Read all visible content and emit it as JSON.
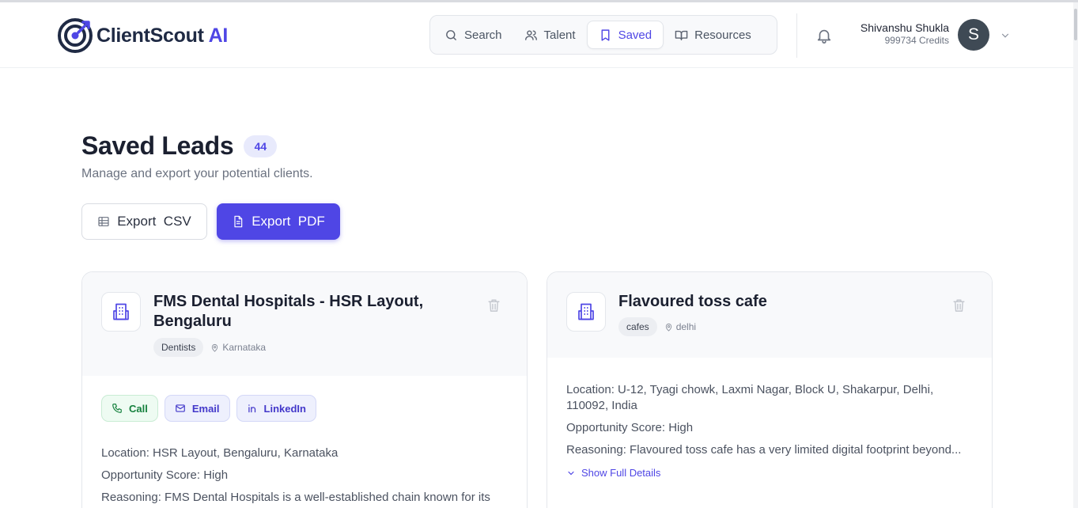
{
  "app": {
    "brand_name": "ClientScout",
    "brand_suffix": "AI",
    "accent_color": "#4f46e5"
  },
  "nav": {
    "items": [
      {
        "label": "Search",
        "icon": "search-icon"
      },
      {
        "label": "Talent",
        "icon": "users-icon"
      },
      {
        "label": "Saved",
        "icon": "bookmark-icon",
        "active": true
      },
      {
        "label": "Resources",
        "icon": "book-open-icon"
      }
    ]
  },
  "user": {
    "name": "Shivanshu Shukla",
    "credits": "999734 Credits",
    "avatar_initial": "S"
  },
  "page": {
    "title": "Saved Leads",
    "count": "44",
    "subtitle": "Manage and export your potential clients.",
    "export_csv_label": "Export  CSV",
    "export_pdf_label": "Export  PDF"
  },
  "leads": [
    {
      "name": "FMS Dental Hospitals - HSR Layout, Bengaluru",
      "category": "Dentists",
      "region": "Karnataka",
      "actions": {
        "call": "Call",
        "email": "Email",
        "linkedin": "LinkedIn"
      },
      "location": "Location: HSR Layout, Bengaluru, Karnataka",
      "score": "Opportunity Score: High",
      "reasoning": "Reasoning: FMS Dental Hospitals is a well-established chain known for its"
    },
    {
      "name": "Flavoured toss cafe",
      "category": "cafes",
      "region": "delhi",
      "location": "Location: U-12, Tyagi chowk, Laxmi Nagar, Block U, Shakarpur, Delhi, 110092, India",
      "score": "Opportunity Score: High",
      "reasoning": "Reasoning: Flavoured toss cafe has a very limited digital footprint beyond...",
      "show_more": "Show Full Details"
    }
  ]
}
